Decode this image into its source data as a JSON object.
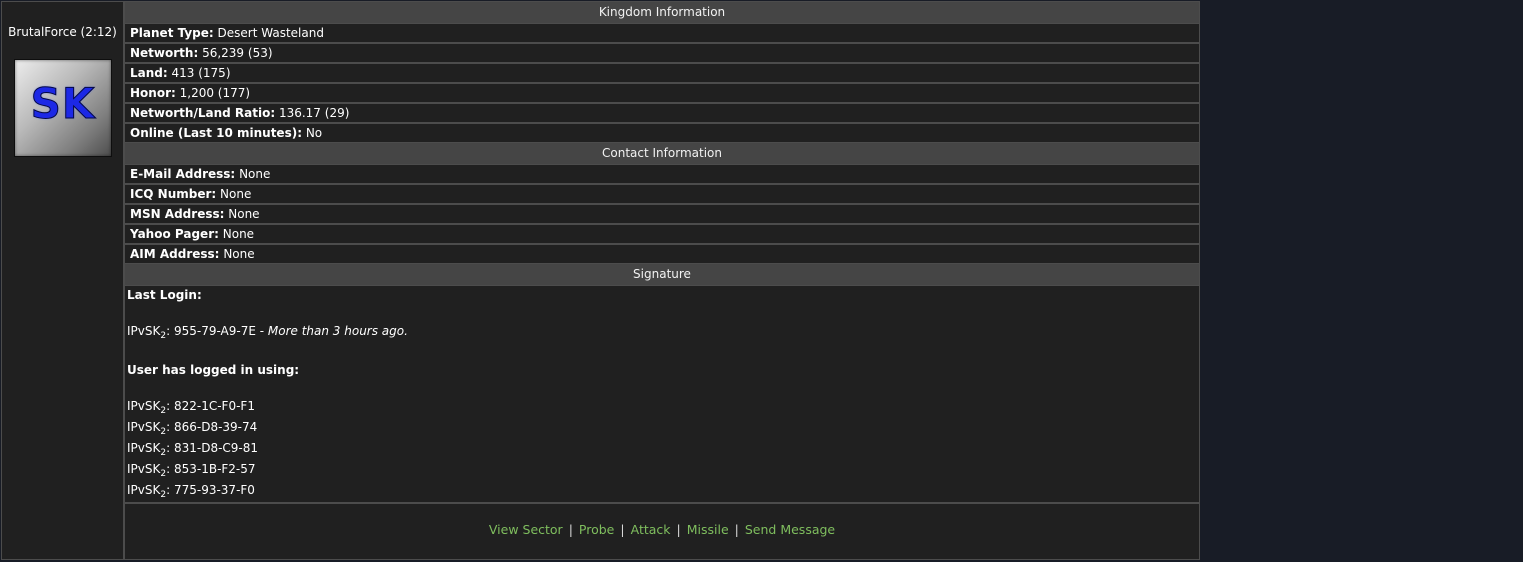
{
  "player": {
    "name": "BrutalForce (2:12)",
    "avatar_text": "SK"
  },
  "kingdom": {
    "header": "Kingdom Information",
    "rows": [
      {
        "label": "Planet Type:",
        "value": "Desert Wasteland"
      },
      {
        "label": "Networth:",
        "value": "56,239 (53)"
      },
      {
        "label": "Land:",
        "value": "413 (175)"
      },
      {
        "label": "Honor:",
        "value": "1,200 (177)"
      },
      {
        "label": "Networth/Land Ratio:",
        "value": "136.17 (29)"
      },
      {
        "label": "Online (Last 10 minutes):",
        "value": "No"
      }
    ]
  },
  "contact": {
    "header": "Contact Information",
    "rows": [
      {
        "label": "E-Mail Address:",
        "value": "None"
      },
      {
        "label": "ICQ Number:",
        "value": "None"
      },
      {
        "label": "MSN Address:",
        "value": "None"
      },
      {
        "label": "Yahoo Pager:",
        "value": "None"
      },
      {
        "label": "AIM Address:",
        "value": "None"
      }
    ]
  },
  "signature": {
    "header": "Signature",
    "last_login_label": "Last Login:",
    "ip_prefix": "IPvSK",
    "ip_sub": "2",
    "last_login_ip": ": 955-79-A9-7E - ",
    "last_login_ago": "More than 3 hours ago.",
    "logged_using_label": "User has logged in using:",
    "ips": [
      ": 822-1C-F0-F1",
      ": 866-D8-39-74",
      ": 831-D8-C9-81",
      ": 853-1B-F2-57",
      ": 775-93-37-F0"
    ]
  },
  "actions": [
    "View Sector",
    "Probe",
    "Attack",
    "Missile",
    "Send Message"
  ],
  "colors": {
    "link": "#7fbe5e",
    "header_bg": "#454545",
    "panel_bg": "#202020",
    "page_bg": "#181c26"
  }
}
